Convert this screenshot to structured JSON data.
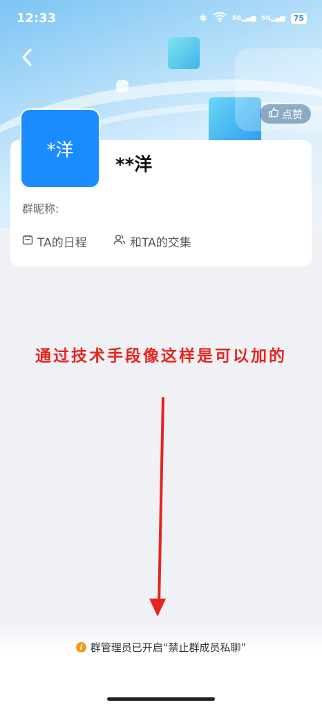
{
  "status_bar": {
    "time": "12:33",
    "network_1": "5G",
    "network_2": "5G",
    "battery": "75"
  },
  "header": {
    "like_label": "点赞"
  },
  "profile": {
    "avatar_text": "*洋",
    "name": "**洋",
    "nickname_label": "群昵称:",
    "schedule_link": "TA的日程",
    "common_link": "和TA的交集"
  },
  "annotation": {
    "text": "通过技术手段像这样是可以加的",
    "color": "#e8231d"
  },
  "footer": {
    "notice": "群管理员已开启“禁止群成员私聊”"
  },
  "colors": {
    "avatar_bg": "#1a8cff",
    "info_icon": "#f39a12"
  }
}
